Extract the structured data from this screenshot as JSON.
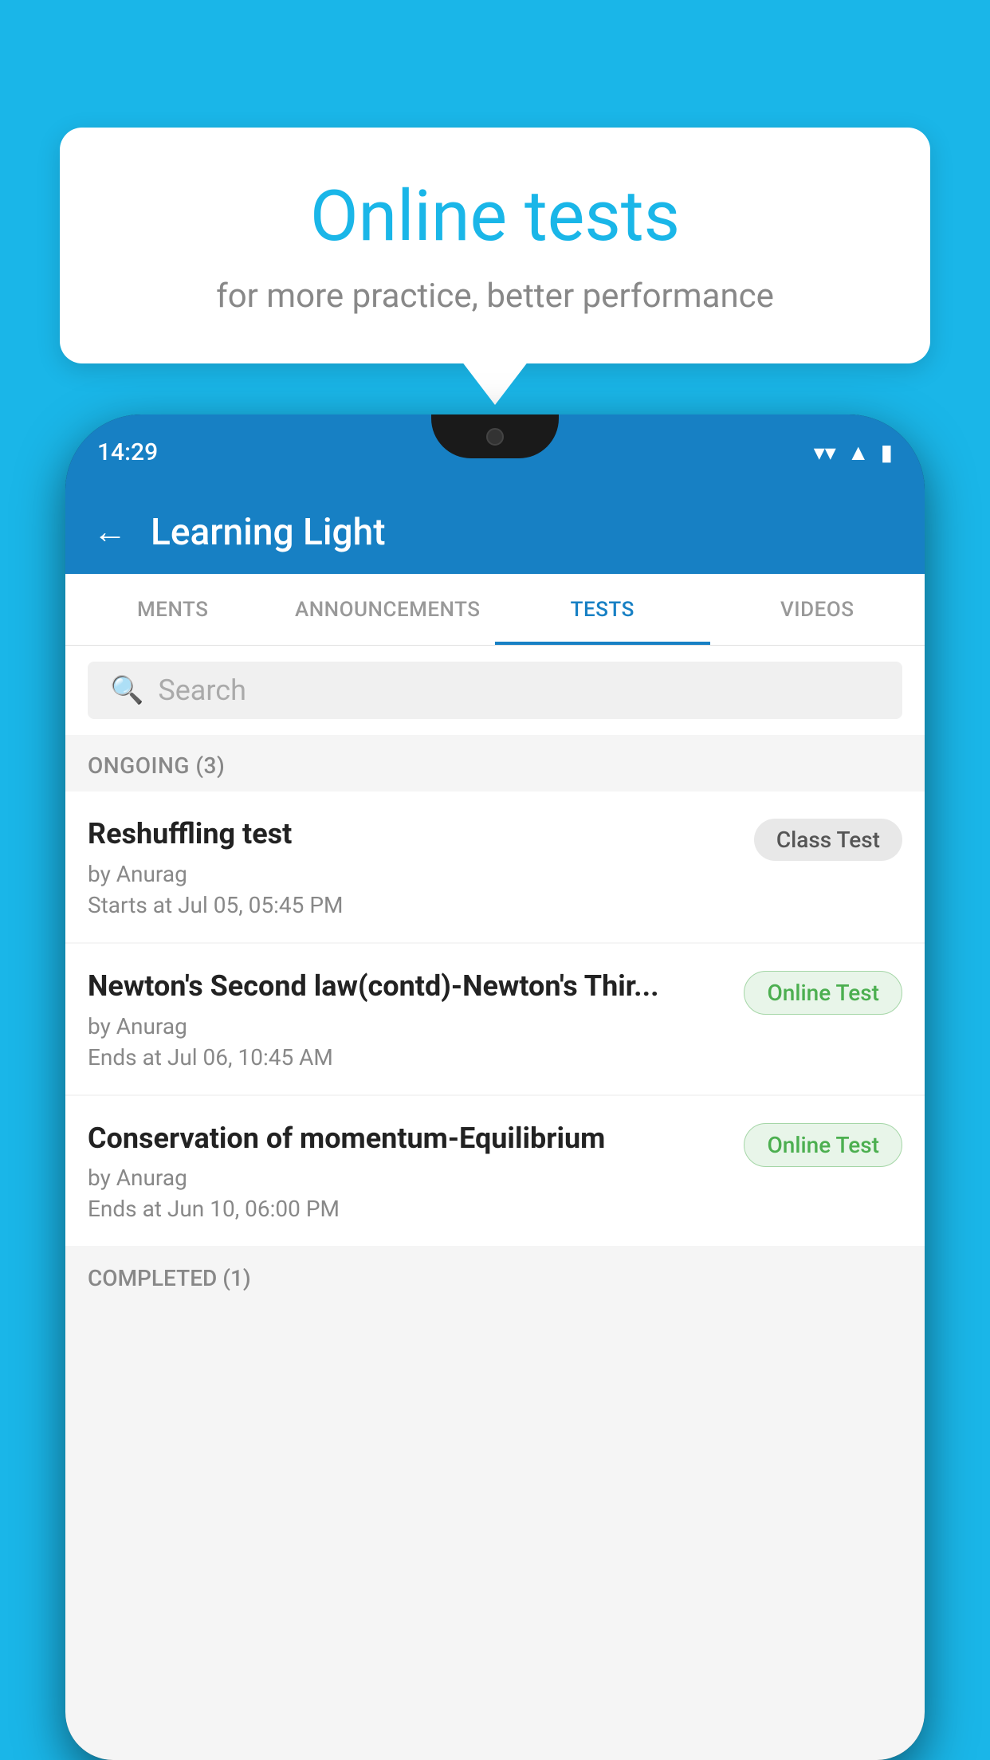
{
  "background_color": "#1ab6e8",
  "speech_bubble": {
    "title": "Online tests",
    "subtitle": "for more practice, better performance"
  },
  "phone": {
    "status_bar": {
      "time": "14:29",
      "wifi_icon": "wifi",
      "signal_icon": "signal",
      "battery_icon": "battery"
    },
    "app_header": {
      "back_label": "←",
      "title": "Learning Light"
    },
    "tabs": [
      {
        "label": "MENTS",
        "active": false
      },
      {
        "label": "ANNOUNCEMENTS",
        "active": false
      },
      {
        "label": "TESTS",
        "active": true
      },
      {
        "label": "VIDEOS",
        "active": false
      }
    ],
    "search": {
      "placeholder": "Search"
    },
    "ongoing_section": {
      "header": "ONGOING (3)",
      "tests": [
        {
          "name": "Reshuffling test",
          "by": "by Anurag",
          "time_label": "Starts at",
          "time": "Jul 05, 05:45 PM",
          "badge": "Class Test",
          "badge_type": "class"
        },
        {
          "name": "Newton's Second law(contd)-Newton's Thir...",
          "by": "by Anurag",
          "time_label": "Ends at",
          "time": "Jul 06, 10:45 AM",
          "badge": "Online Test",
          "badge_type": "online"
        },
        {
          "name": "Conservation of momentum-Equilibrium",
          "by": "by Anurag",
          "time_label": "Ends at",
          "time": "Jun 10, 06:00 PM",
          "badge": "Online Test",
          "badge_type": "online"
        }
      ]
    },
    "completed_section": {
      "header": "COMPLETED (1)"
    }
  }
}
